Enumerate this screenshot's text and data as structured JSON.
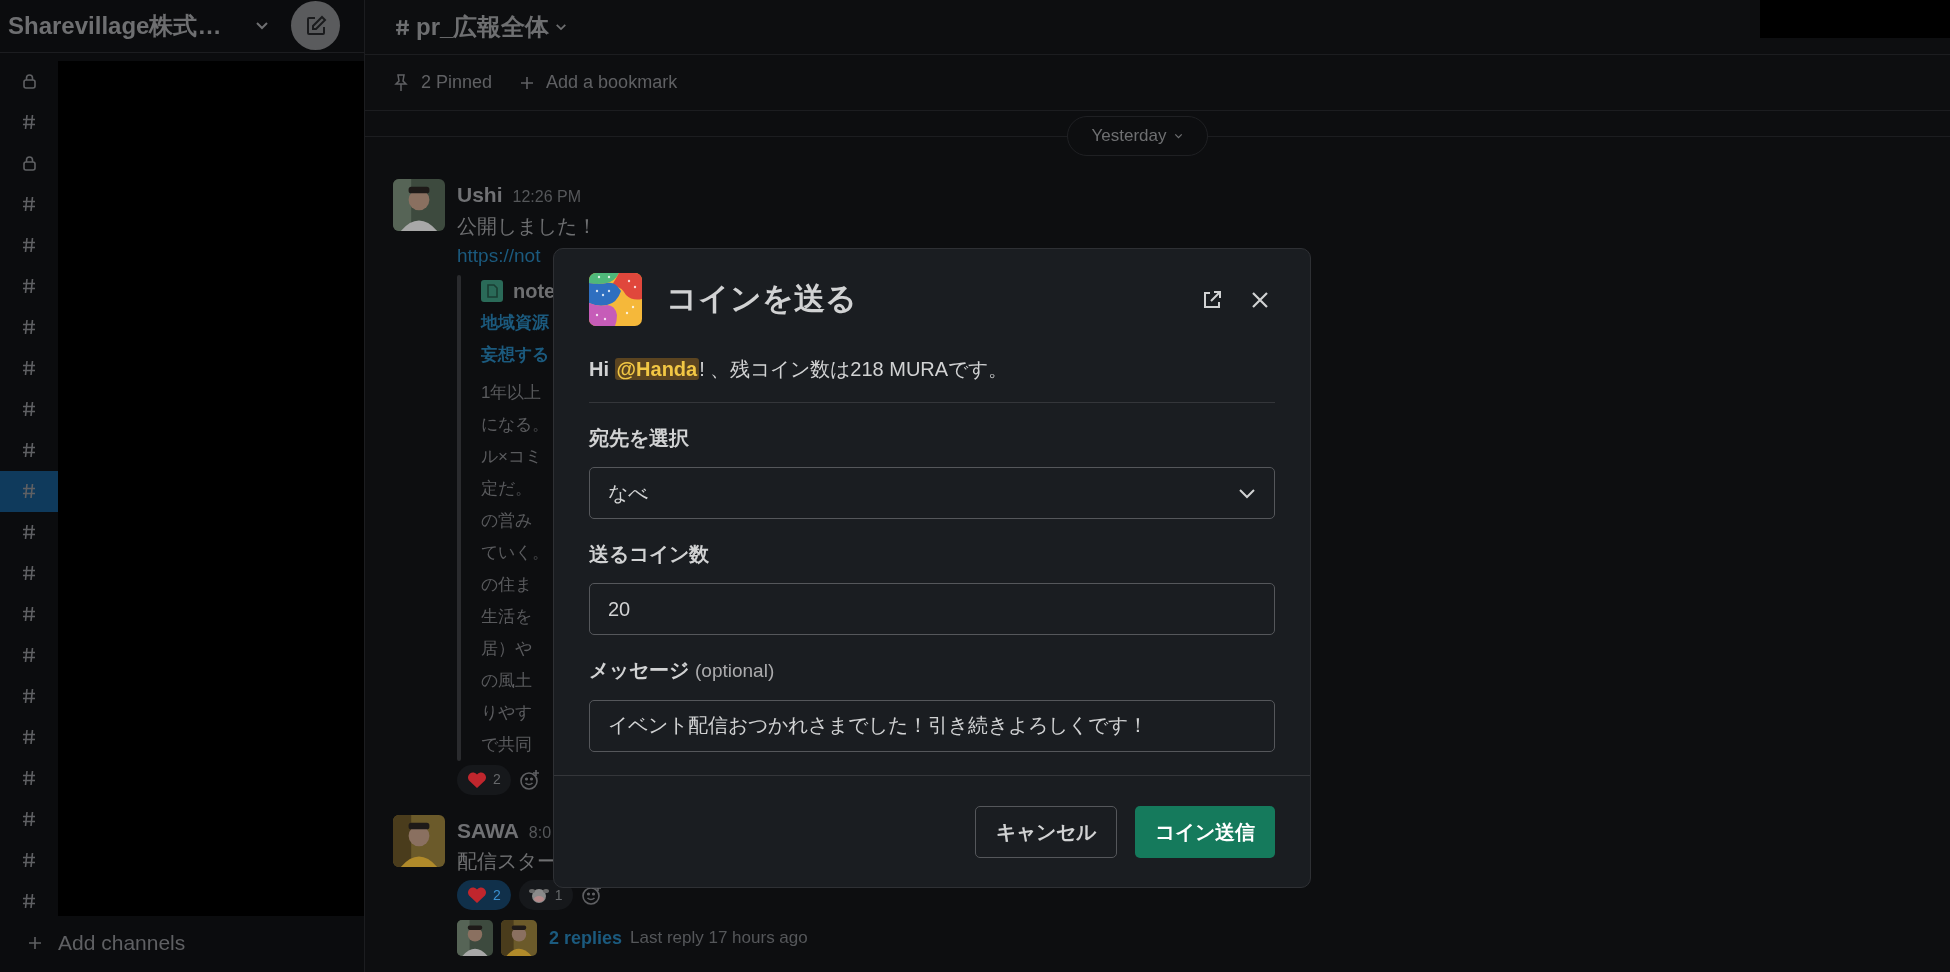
{
  "workspace": {
    "name": "Sharevillage株式…"
  },
  "sidebar": {
    "channels": [
      {
        "kind": "lock",
        "selected": false
      },
      {
        "kind": "hash",
        "selected": false
      },
      {
        "kind": "lock",
        "selected": false
      },
      {
        "kind": "hash",
        "selected": false
      },
      {
        "kind": "hash",
        "selected": false
      },
      {
        "kind": "hash",
        "selected": false
      },
      {
        "kind": "hash",
        "selected": false
      },
      {
        "kind": "hash",
        "selected": false
      },
      {
        "kind": "hash",
        "selected": false
      },
      {
        "kind": "hash",
        "selected": false
      },
      {
        "kind": "hash",
        "selected": true
      },
      {
        "kind": "hash",
        "selected": false
      },
      {
        "kind": "hash",
        "selected": false
      },
      {
        "kind": "hash",
        "selected": false
      },
      {
        "kind": "hash",
        "selected": false
      },
      {
        "kind": "hash",
        "selected": false
      },
      {
        "kind": "hash",
        "selected": false
      },
      {
        "kind": "hash",
        "selected": false
      },
      {
        "kind": "hash",
        "selected": false
      },
      {
        "kind": "hash",
        "selected": false
      },
      {
        "kind": "hash",
        "selected": false
      }
    ],
    "add_channels": "Add channels"
  },
  "channel": {
    "name": "pr_広報全体",
    "pinned": "2 Pinned",
    "bookmark": "Add a bookmark",
    "date_divider": "Yesterday"
  },
  "messages": [
    {
      "author": "Ushi",
      "time": "12:26 PM",
      "text": "公開しました！",
      "link": "https://not",
      "attachment": {
        "source": "note",
        "title_lines": [
          "地域資源",
          "妄想する"
        ],
        "body_lines": [
          "1年以上",
          "になる。",
          "ル×コミ",
          "定だ。",
          "の営み",
          "ていく。",
          "の住ま",
          "生活を",
          "居）や",
          "の風土",
          "りやす",
          "で共同"
        ]
      },
      "reactions": [
        {
          "kind": "heart",
          "count": "2",
          "selected": false
        }
      ]
    },
    {
      "author": "SAWA",
      "time": "8:0",
      "text": "配信スター",
      "reactions": [
        {
          "kind": "heart",
          "count": "2",
          "selected": true
        },
        {
          "kind": "cow",
          "count": "1",
          "selected": false
        }
      ],
      "replies": {
        "count": "2 replies",
        "last": "Last reply 17 hours ago"
      }
    }
  ],
  "modal": {
    "title": "コインを送る",
    "greeting_before": "Hi ",
    "mention": "@Handa",
    "greeting_after": "! 、残コイン数は218 MURAです。",
    "fields": [
      {
        "kind": "select",
        "label": "宛先を選択",
        "value": "なべ"
      },
      {
        "kind": "input",
        "label": "送るコイン数",
        "value": "20"
      },
      {
        "kind": "input",
        "label": "メッセージ",
        "hint": "(optional)",
        "value": "イベント配信おつかれさまでした！引き続きよろしくです！"
      }
    ],
    "buttons": [
      {
        "kind": "secondary",
        "label": "キャンセル"
      },
      {
        "kind": "primary",
        "label": "コイン送信"
      }
    ]
  }
}
